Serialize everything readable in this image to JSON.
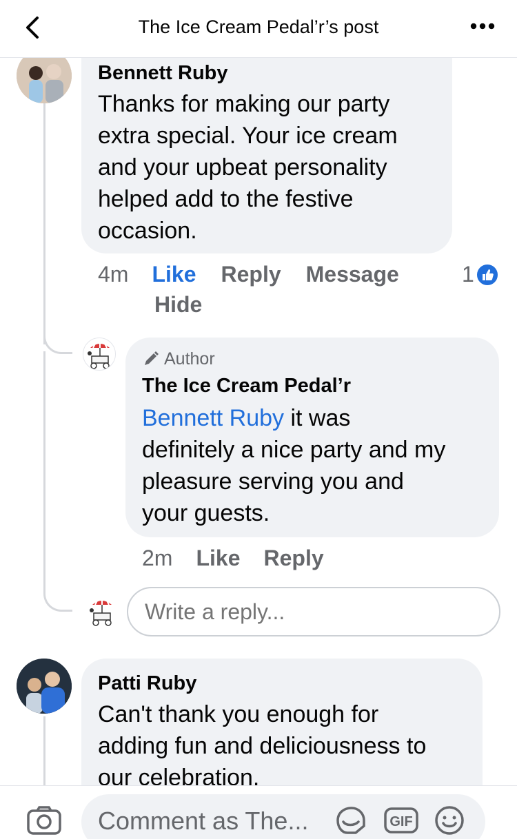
{
  "header": {
    "title": "The Ice Cream Pedal’r’s post"
  },
  "comments": [
    {
      "name": "Bennett Ruby",
      "text_lines": [
        "Thanks for making our party",
        "extra special.  Your ice cream",
        "and your upbeat personality",
        "helped add to the festive",
        "occasion."
      ],
      "time": "4m",
      "actions": [
        "Like",
        "Reply",
        "Message"
      ],
      "hide": "Hide",
      "reaction_count": "1"
    }
  ],
  "reply": {
    "author_tag": "Author",
    "name": "The Ice Cream Pedal’r",
    "mention": "Bennett Ruby",
    "line1_rest": " it was",
    "text_lines": [
      "definitely a nice party and my",
      "pleasure serving you and",
      "your guests."
    ],
    "time": "2m",
    "actions": [
      "Like",
      "Reply"
    ]
  },
  "reply_input": {
    "placeholder": "Write a reply..."
  },
  "comment2": {
    "name": "Patti Ruby",
    "text_lines": [
      "Can't thank you enough for",
      "adding fun and deliciousness to",
      "our celebration."
    ]
  },
  "bottom": {
    "placeholder": "Comment as The..."
  },
  "colors": {
    "accent": "#216fdb",
    "bubble": "#f0f2f5",
    "secondary_text": "#65676b"
  }
}
